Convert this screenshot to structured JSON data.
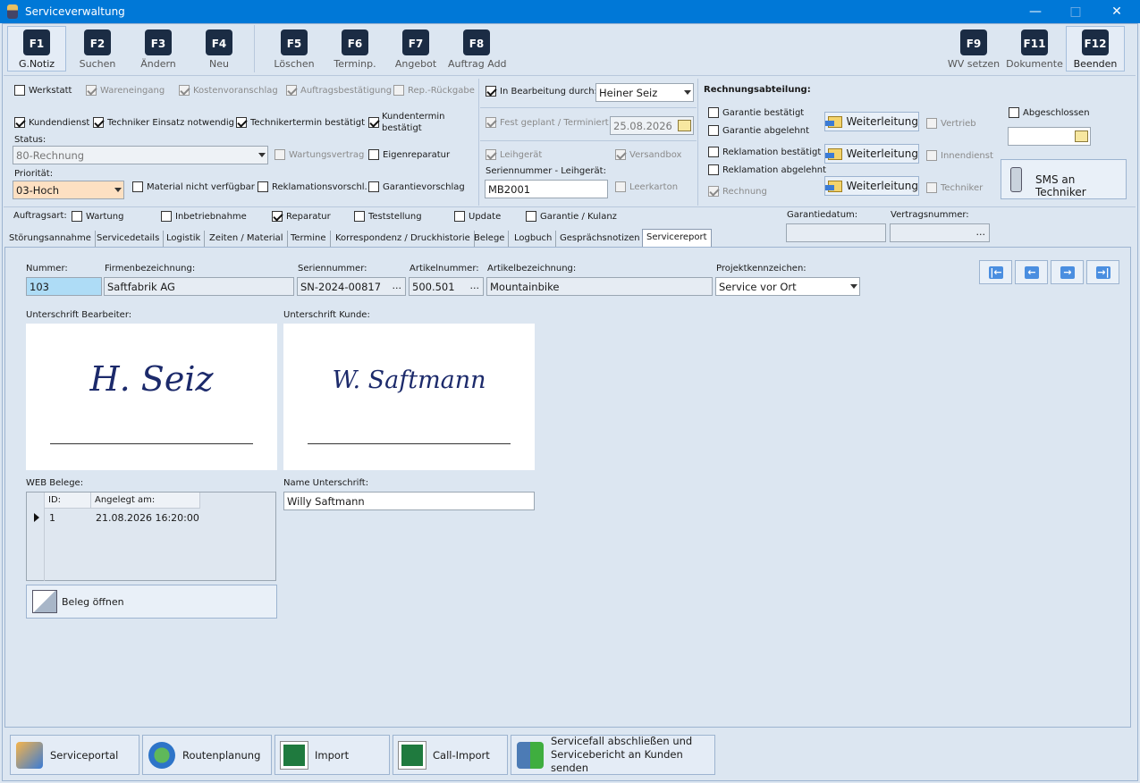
{
  "window": {
    "title": "Serviceverwaltung"
  },
  "fkeys": [
    {
      "key": "F1",
      "label": "G.Notiz"
    },
    {
      "key": "F2",
      "label": "Suchen"
    },
    {
      "key": "F3",
      "label": "Ändern"
    },
    {
      "key": "F4",
      "label": "Neu"
    },
    {
      "key": "F5",
      "label": "Löschen"
    },
    {
      "key": "F6",
      "label": "Terminp."
    },
    {
      "key": "F7",
      "label": "Angebot"
    },
    {
      "key": "F8",
      "label": "Auftrag Add"
    },
    {
      "key": "F9",
      "label": "WV setzen"
    },
    {
      "key": "F11",
      "label": "Dokumente"
    },
    {
      "key": "F12",
      "label": "Beenden"
    }
  ],
  "row1": {
    "werkstatt": "Werkstatt",
    "wareneingang": "Wareneingang",
    "kostenvoranschlag": "Kostenvoranschlag",
    "auftragsbestaetigung": "Auftragsbestätigung",
    "rep_rueckgabe": "Rep.-Rückgabe"
  },
  "row2": {
    "kundendienst": "Kundendienst",
    "techniker_einsatz": "Techniker Einsatz notwendig",
    "technikertermin": "Technikertermin bestätigt",
    "kundentermin_1": "Kundentermin",
    "kundentermin_2": "bestätigt"
  },
  "status": {
    "label": "Status:",
    "value": "80-Rechnung"
  },
  "wartungsvertrag": "Wartungsvertrag",
  "eigenreparatur": "Eigenreparatur",
  "prioritaet": {
    "label": "Priorität:",
    "value": "03-Hoch"
  },
  "material": "Material nicht verfügbar",
  "reklamationsvorschl": "Reklamationsvorschl.",
  "garantievorschlag": "Garantievorschlag",
  "bearbeitung": {
    "label": "In Bearbeitung durch:",
    "value": "Heiner Seiz"
  },
  "fest_geplant": {
    "label": "Fest geplant / Terminiert",
    "date": "25.08.2026"
  },
  "leihgeraet": "Leihgerät",
  "versandbox": "Versandbox",
  "seriennummer_leih": {
    "label": "Seriennummer - Leihgerät:",
    "value": "MB2001"
  },
  "leerkarton": "Leerkarton",
  "rechnungsabteilung": {
    "title": "Rechnungsabteilung:",
    "garantie_bestaetigt": "Garantie bestätigt",
    "garantie_abgelehnt": "Garantie abgelehnt",
    "reklamation_bestaetigt": "Reklamation bestätigt",
    "reklamation_abgelehnt": "Reklamation abgelehnt",
    "rechnung": "Rechnung",
    "weiterleitung": "Weiterleitung",
    "vertrieb": "Vertrieb",
    "innendienst": "Innendienst",
    "techniker": "Techniker",
    "abgeschlossen": "Abgeschlossen",
    "sms": "SMS an Techniker"
  },
  "auftragsart": {
    "label": "Auftragsart:",
    "items": [
      "Wartung",
      "Inbetriebnahme",
      "Reparatur",
      "Teststellung",
      "Update",
      "Garantie / Kulanz"
    ]
  },
  "garantiedatum": {
    "label": "Garantiedatum:",
    "value": ""
  },
  "vertragsnummer": {
    "label": "Vertragsnummer:",
    "value": ""
  },
  "tabs": [
    "Störungsannahme",
    "Servicedetails",
    "Logistik",
    "Zeiten / Material",
    "Termine",
    "Korrespondenz / Druckhistorie",
    "Belege",
    "Logbuch",
    "Gesprächsnotizen",
    "Servicereport"
  ],
  "report": {
    "nummer": {
      "label": "Nummer:",
      "value": "103"
    },
    "firma": {
      "label": "Firmenbezeichnung:",
      "value": "Saftfabrik AG"
    },
    "seriennummer": {
      "label": "Seriennummer:",
      "value": "SN-2024-00817"
    },
    "artikelnummer": {
      "label": "Artikelnummer:",
      "value": "500.501"
    },
    "artikelbezeichnung": {
      "label": "Artikelbezeichnung:",
      "value": "Mountainbike"
    },
    "projekt": {
      "label": "Projektkennzeichen:",
      "value": "Service vor Ort"
    },
    "sig_bearbeiter": {
      "label": "Unterschrift Bearbeiter:",
      "text": "H. Seiz"
    },
    "sig_kunde": {
      "label": "Unterschrift Kunde:",
      "text": "W. Saftmann"
    },
    "web_belege": {
      "label": "WEB Belege:",
      "columns": [
        "ID:",
        "Angelegt am:"
      ],
      "rows": [
        {
          "id": "1",
          "date": "21.08.2026 16:20:00"
        }
      ]
    },
    "beleg_oeffnen": "Beleg öffnen",
    "name_unterschrift": {
      "label": "Name Unterschrift:",
      "value": "Willy Saftmann"
    }
  },
  "bottom": [
    "Serviceportal",
    "Routenplanung",
    "Import",
    "Call-Import",
    "Servicefall abschließen und",
    "Servicebericht an Kunden senden"
  ]
}
